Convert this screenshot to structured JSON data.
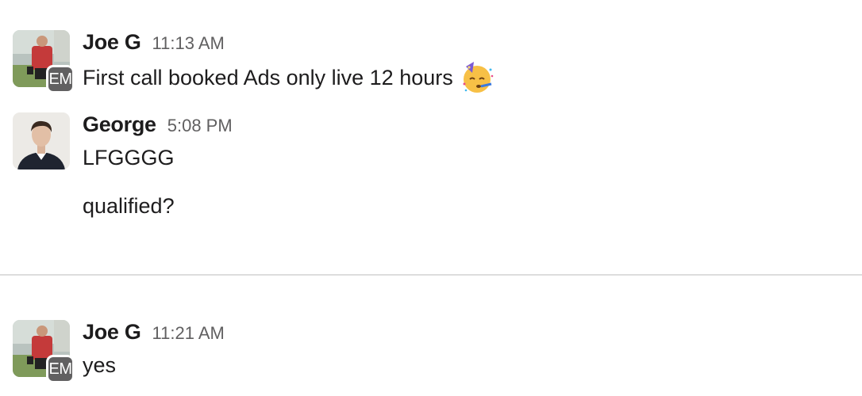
{
  "messages": [
    {
      "sender": "Joe G",
      "time": "11:13 AM",
      "badge": "EM",
      "text": "First call booked Ads only live 12 hours",
      "emoji": "partying-face-icon"
    },
    {
      "sender": "George",
      "time": "5:08 PM",
      "text_lines": [
        "LFGGGG",
        "qualified?"
      ]
    },
    {
      "sender": "Joe G",
      "time": "11:21 AM",
      "badge": "EM",
      "text": "yes"
    }
  ],
  "colors": {
    "badge_bg": "#616061",
    "timestamp": "#616061",
    "divider": "#dddddd"
  }
}
